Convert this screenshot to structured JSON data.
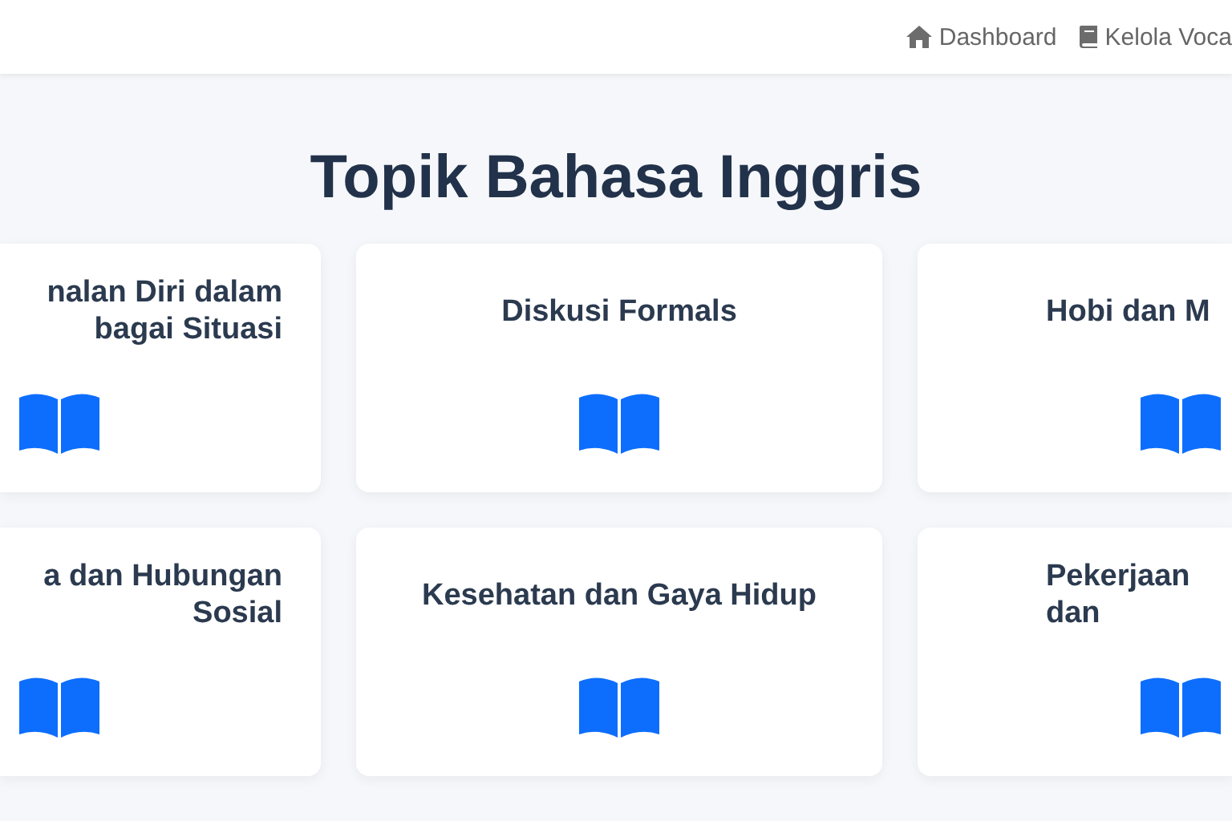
{
  "nav": [
    {
      "kind": "home",
      "label": "Dashboard"
    },
    {
      "kind": "book",
      "label": "Kelola Voca"
    }
  ],
  "title": "Topik Bahasa Inggris",
  "topics": [
    {
      "title": "nalan Diri dalam bagai Situasi"
    },
    {
      "title": "Diskusi Formals"
    },
    {
      "title": "Hobi dan M"
    },
    {
      "title": "a dan Hubungan Sosial"
    },
    {
      "title": "Kesehatan dan Gaya Hidup"
    },
    {
      "title": "Pekerjaan dan"
    }
  ]
}
